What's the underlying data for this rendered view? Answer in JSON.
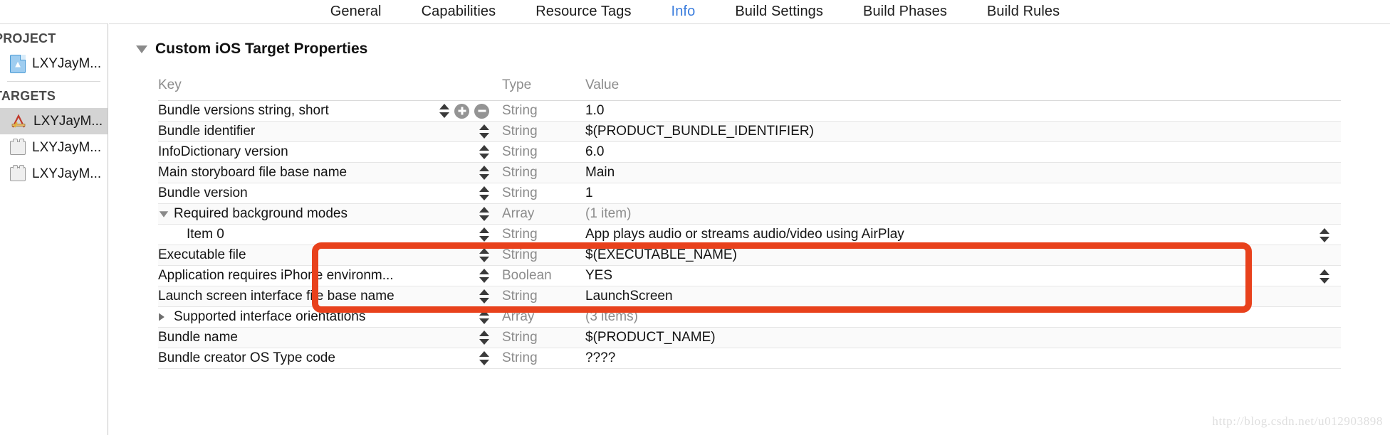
{
  "tabs": [
    {
      "label": "General",
      "selected": false
    },
    {
      "label": "Capabilities",
      "selected": false
    },
    {
      "label": "Resource Tags",
      "selected": false
    },
    {
      "label": "Info",
      "selected": true
    },
    {
      "label": "Build Settings",
      "selected": false
    },
    {
      "label": "Build Phases",
      "selected": false
    },
    {
      "label": "Build Rules",
      "selected": false
    }
  ],
  "sidebar": {
    "project_header": "PROJECT",
    "targets_header": "TARGETS",
    "project_items": [
      {
        "label": "LXYJayM...",
        "icon": "xcode-project-icon",
        "selected": false
      }
    ],
    "target_items": [
      {
        "label": "LXYJayM...",
        "icon": "app-target-icon",
        "selected": true
      },
      {
        "label": "LXYJayM...",
        "icon": "bundle-target-icon",
        "selected": false
      },
      {
        "label": "LXYJayM...",
        "icon": "bundle-target-icon",
        "selected": false
      }
    ]
  },
  "main": {
    "section_title": "Custom iOS Target Properties",
    "columns": {
      "key": "Key",
      "type": "Type",
      "value": "Value"
    },
    "rows": [
      {
        "key": "Bundle versions string, short",
        "type": "String",
        "value": "1.0",
        "indent": 0,
        "disclosure": "none",
        "muted_value": false,
        "show_add_remove": true,
        "right_stepper": false
      },
      {
        "key": "Bundle identifier",
        "type": "String",
        "value": "$(PRODUCT_BUNDLE_IDENTIFIER)",
        "indent": 0,
        "disclosure": "none",
        "muted_value": false,
        "show_add_remove": false,
        "right_stepper": false
      },
      {
        "key": "InfoDictionary version",
        "type": "String",
        "value": "6.0",
        "indent": 0,
        "disclosure": "none",
        "muted_value": false,
        "show_add_remove": false,
        "right_stepper": false
      },
      {
        "key": "Main storyboard file base name",
        "type": "String",
        "value": "Main",
        "indent": 0,
        "disclosure": "none",
        "muted_value": false,
        "show_add_remove": false,
        "right_stepper": false
      },
      {
        "key": "Bundle version",
        "type": "String",
        "value": "1",
        "indent": 0,
        "disclosure": "none",
        "muted_value": false,
        "show_add_remove": false,
        "right_stepper": false
      },
      {
        "key": "Required background modes",
        "type": "Array",
        "value": "(1 item)",
        "indent": 0,
        "disclosure": "expanded",
        "muted_value": true,
        "show_add_remove": false,
        "right_stepper": false
      },
      {
        "key": "Item 0",
        "type": "String",
        "value": "App plays audio or streams audio/video using AirPlay",
        "indent": 1,
        "disclosure": "none",
        "muted_value": false,
        "show_add_remove": false,
        "right_stepper": true
      },
      {
        "key": "Executable file",
        "type": "String",
        "value": "$(EXECUTABLE_NAME)",
        "indent": 0,
        "disclosure": "none",
        "muted_value": false,
        "show_add_remove": false,
        "right_stepper": false
      },
      {
        "key": "Application requires iPhone environm...",
        "type": "Boolean",
        "value": "YES",
        "indent": 0,
        "disclosure": "none",
        "muted_value": false,
        "show_add_remove": false,
        "right_stepper": true
      },
      {
        "key": "Launch screen interface file base name",
        "type": "String",
        "value": "LaunchScreen",
        "indent": 0,
        "disclosure": "none",
        "muted_value": false,
        "show_add_remove": false,
        "right_stepper": false
      },
      {
        "key": "Supported interface orientations",
        "type": "Array",
        "value": "(3 items)",
        "indent": 0,
        "disclosure": "collapsed",
        "muted_value": true,
        "show_add_remove": false,
        "right_stepper": false
      },
      {
        "key": "Bundle name",
        "type": "String",
        "value": "$(PRODUCT_NAME)",
        "indent": 0,
        "disclosure": "none",
        "muted_value": false,
        "show_add_remove": false,
        "right_stepper": false
      },
      {
        "key": "Bundle creator OS Type code",
        "type": "String",
        "value": "????",
        "indent": 0,
        "disclosure": "none",
        "muted_value": false,
        "show_add_remove": false,
        "right_stepper": false
      }
    ]
  },
  "annotation": {
    "color": "#e8411c",
    "shape": "rounded-rectangle"
  },
  "watermark": "http://blog.csdn.net/u012903898"
}
